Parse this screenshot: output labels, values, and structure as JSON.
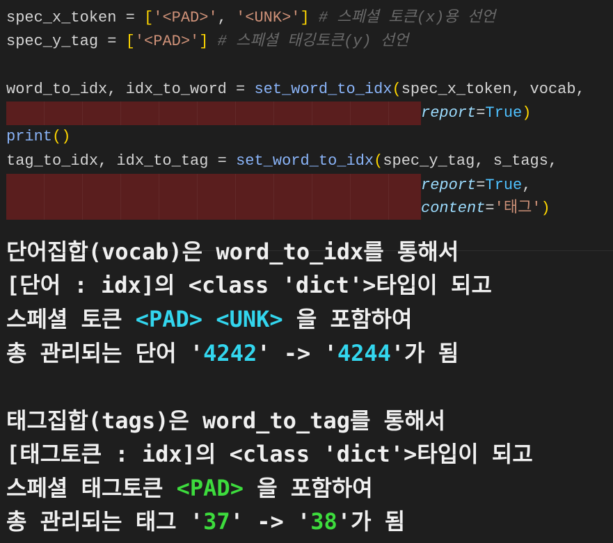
{
  "code": {
    "l1": {
      "lhs": "spec_x_token",
      "eq": " = ",
      "ob": "[",
      "s1": "'<PAD>'",
      "comma": ", ",
      "s2": "'<UNK>'",
      "cb": "]",
      "comment": " # 스페셜 토큰(x)용 선언"
    },
    "l2": {
      "lhs": "spec_y_tag",
      "eq": " = ",
      "ob": "[",
      "s1": "'<PAD>'",
      "cb": "]",
      "comment": " # 스페셜 태깅토큰(y) 선언"
    },
    "l3": {
      "lhs": "word_to_idx, idx_to_word",
      "eq": " = ",
      "fn": "set_word_to_idx",
      "op": "(",
      "args": "spec_x_token, vocab,"
    },
    "l4": {
      "param": "report",
      "eq": "=",
      "val": "True",
      "cp": ")"
    },
    "l5": {
      "fn": "print",
      "p": "()"
    },
    "l6": {
      "lhs": "tag_to_idx, idx_to_tag",
      "eq": " = ",
      "fn": "set_word_to_idx",
      "op": "(",
      "args": "spec_y_tag, s_tags,"
    },
    "l7": {
      "param": "report",
      "eq": "=",
      "val": "True",
      "comma": ","
    },
    "l8": {
      "param": "content",
      "eq": "=",
      "val": "'태그'",
      "cp": ")"
    }
  },
  "output": {
    "vocab": {
      "line1": "단어집합(vocab)은 word_to_idx를 통해서",
      "line2": "[단어 : idx]의 <class 'dict'>타입이 되고",
      "line3_a": "스페셜 토큰 ",
      "pad": "<PAD>",
      "unk": "<UNK>",
      "line3_b": " 을 포함하여",
      "line4_a": "총 관리되는 단어 '",
      "from": "4242",
      "mid": "' -> '",
      "to": "4244",
      "line4_b": "'가 됨"
    },
    "tags": {
      "line1": "태그집합(tags)은 word_to_tag를 통해서",
      "line2": "[태그토큰 : idx]의 <class 'dict'>타입이 되고",
      "line3_a": "스페셜 태그토큰 ",
      "pad": "<PAD>",
      "line3_b": " 을 포함하여",
      "line4_a": "총 관리되는 태그 '",
      "from": "37",
      "mid": "' -> '",
      "to": "38",
      "line4_b": "'가 됨"
    }
  },
  "colors": {
    "highlight": "#5a1e1e",
    "cyan": "#33d6ee",
    "green": "#3ddc3d",
    "background": "#1e1e1e"
  }
}
